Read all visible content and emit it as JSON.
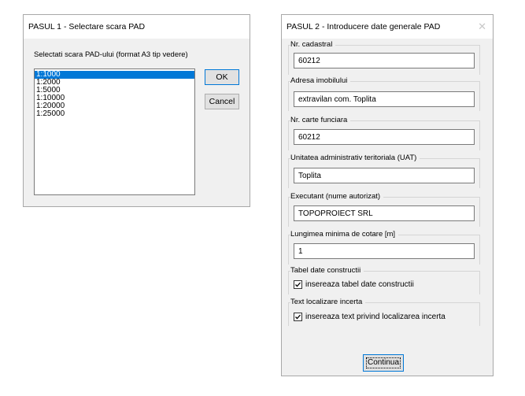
{
  "step1": {
    "title": "PASUL 1 - Selectare scara PAD",
    "prompt": "Selectati scara PAD-ului (format A3 tip vedere)",
    "scales": [
      "1:1000",
      "1:2000",
      "1:5000",
      "1:10000",
      "1:20000",
      "1:25000"
    ],
    "selected_index": 0,
    "ok_label": "OK",
    "cancel_label": "Cancel"
  },
  "step2": {
    "title": "PASUL 2 - Introducere date generale PAD",
    "close_glyph": "✕",
    "fields": [
      {
        "label": "Nr. cadastral",
        "value": "60212"
      },
      {
        "label": "Adresa imobilului",
        "value": "extravilan com. Toplita"
      },
      {
        "label": "Nr. carte funciara",
        "value": "60212"
      },
      {
        "label": "Unitatea administrativ teritoriala (UAT)",
        "value": "Toplita"
      },
      {
        "label": "Executant (nume autorizat)",
        "value": "TOPOPROIECT SRL"
      },
      {
        "label": "Lungimea minima de cotare [m]",
        "value": "1"
      }
    ],
    "groups": [
      {
        "label": "Tabel date constructii",
        "checkbox_label": "insereaza tabel date constructii",
        "checked": true
      },
      {
        "label": "Text localizare incerta",
        "checkbox_label": "insereaza text privind localizarea incerta",
        "checked": true
      }
    ],
    "continue_label": "Continua"
  },
  "colors": {
    "selection": "#0078d7",
    "dialog_bg": "#f0f0f0"
  }
}
